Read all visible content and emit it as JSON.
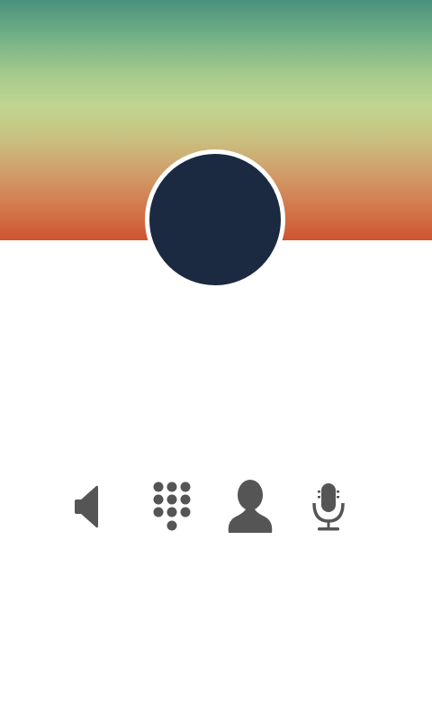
{
  "call_screen": {
    "header": {
      "gradient_colors": [
        "#4a917c",
        "#c0d590",
        "#cf5530"
      ]
    },
    "avatar": {
      "fill_color": "#1b2a40",
      "border_color": "#ffffff"
    },
    "controls": [
      {
        "id": "speaker",
        "icon": "speaker-icon",
        "color": "#555555"
      },
      {
        "id": "keypad",
        "icon": "dialpad-icon",
        "color": "#555555"
      },
      {
        "id": "add-contact",
        "icon": "person-icon",
        "color": "#555555"
      },
      {
        "id": "mute",
        "icon": "microphone-icon",
        "color": "#555555"
      }
    ]
  }
}
